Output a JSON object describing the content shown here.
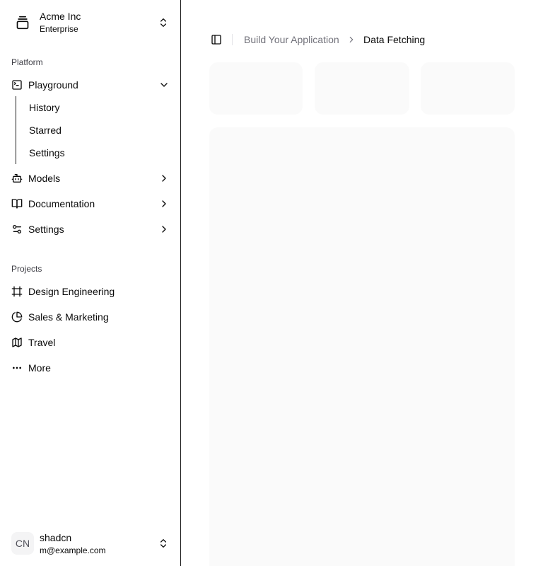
{
  "team": {
    "name": "Acme Inc",
    "plan": "Enterprise",
    "logo_icon": "gallery-vertical-end-icon"
  },
  "sidebar": {
    "platform_label": "Platform",
    "platform_items": [
      {
        "label": "Playground",
        "icon": "terminal-square-icon",
        "expanded": true,
        "children": [
          "History",
          "Starred",
          "Settings"
        ]
      },
      {
        "label": "Models",
        "icon": "bot-icon",
        "expanded": false
      },
      {
        "label": "Documentation",
        "icon": "book-open-icon",
        "expanded": false
      },
      {
        "label": "Settings",
        "icon": "settings-2-icon",
        "expanded": false
      }
    ],
    "projects_label": "Projects",
    "projects": [
      {
        "label": "Design Engineering",
        "icon": "frame-icon"
      },
      {
        "label": "Sales & Marketing",
        "icon": "pie-chart-icon"
      },
      {
        "label": "Travel",
        "icon": "map-icon"
      },
      {
        "label": "More",
        "icon": "more-horizontal-icon"
      }
    ]
  },
  "user": {
    "initials": "CN",
    "name": "shadcn",
    "email": "m@example.com"
  },
  "breadcrumb": {
    "parent": "Build Your Application",
    "current": "Data Fetching"
  },
  "colors": {
    "border": "#1a1a1a",
    "muted_text": "#71717a",
    "skeleton": "#fafafa"
  }
}
